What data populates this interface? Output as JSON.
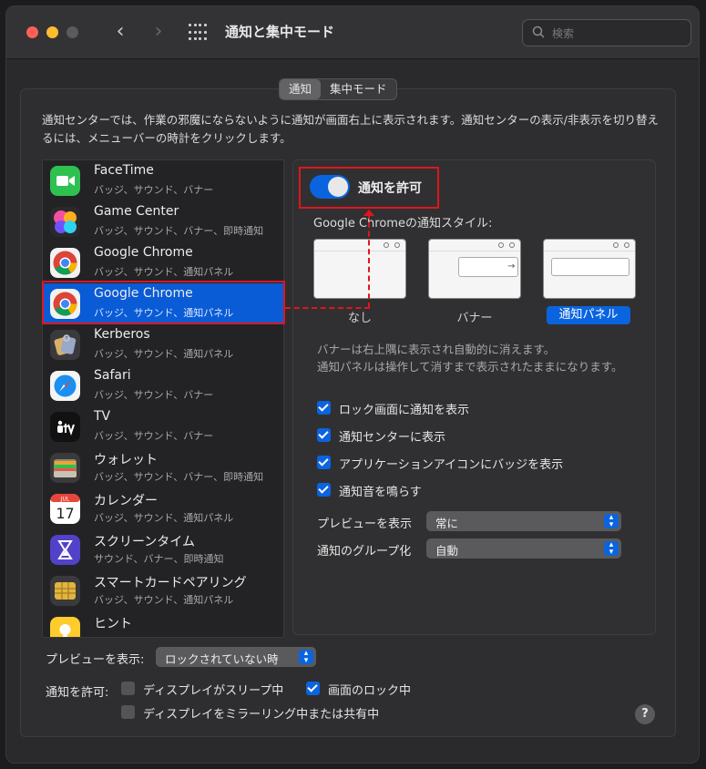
{
  "window": {
    "title": "通知と集中モード"
  },
  "search": {
    "placeholder": "検索"
  },
  "tabs": [
    {
      "label": "通知",
      "active": true
    },
    {
      "label": "集中モード",
      "active": false
    }
  ],
  "description": "通知センターでは、作業の邪魔にならないように通知が画面右上に表示されます。通知センターの表示/非表示を切り替えるには、メニューバーの時計をクリックします。",
  "apps": [
    {
      "name": "FaceTime",
      "sub": "バッジ、サウンド、バナー",
      "icon": "facetime-icon"
    },
    {
      "name": "Game Center",
      "sub": "バッジ、サウンド、バナー、即時通知",
      "icon": "game-center-icon"
    },
    {
      "name": "Google Chrome",
      "sub": "バッジ、サウンド、通知パネル",
      "icon": "chrome-icon"
    },
    {
      "name": "Google Chrome",
      "sub": "バッジ、サウンド、通知パネル",
      "icon": "chrome-icon",
      "selected": true
    },
    {
      "name": "Kerberos",
      "sub": "バッジ、サウンド、通知パネル",
      "icon": "kerberos-icon"
    },
    {
      "name": "Safari",
      "sub": "バッジ、サウンド、バナー",
      "icon": "safari-icon"
    },
    {
      "name": "TV",
      "sub": "バッジ、サウンド、バナー",
      "icon": "tv-icon"
    },
    {
      "name": "ウォレット",
      "sub": "バッジ、サウンド、バナー、即時通知",
      "icon": "wallet-icon"
    },
    {
      "name": "カレンダー",
      "sub": "バッジ、サウンド、通知パネル",
      "icon": "calendar-icon"
    },
    {
      "name": "スクリーンタイム",
      "sub": "サウンド、バナー、即時通知",
      "icon": "screen-time-icon"
    },
    {
      "name": "スマートカードペアリング",
      "sub": "バッジ、サウンド、通知パネル",
      "icon": "smartcard-icon"
    },
    {
      "name": "ヒント",
      "sub": "",
      "icon": "tips-icon"
    }
  ],
  "calendar_icon": {
    "month": "JUL",
    "day": "17"
  },
  "allow": {
    "label": "通知を許可",
    "on": true
  },
  "style": {
    "title": "Google Chromeの通知スタイル:",
    "options": [
      "なし",
      "バナー",
      "通知パネル"
    ],
    "selected": "通知パネル"
  },
  "hint": "バナーは右上隅に表示され自動的に消えます。\n通知パネルは操作して消すまで表示されたままになります。",
  "checkboxes": [
    {
      "label": "ロック画面に通知を表示",
      "checked": true
    },
    {
      "label": "通知センターに表示",
      "checked": true
    },
    {
      "label": "アプリケーションアイコンにバッジを表示",
      "checked": true
    },
    {
      "label": "通知音を鳴らす",
      "checked": true
    }
  ],
  "preview": {
    "label": "プレビューを表示",
    "value": "常に"
  },
  "grouping": {
    "label": "通知のグループ化",
    "value": "自動"
  },
  "bottom": {
    "preview_label": "プレビューを表示:",
    "preview_value": "ロックされていない時",
    "allow_label": "通知を許可:",
    "display_sleep": {
      "label": "ディスプレイがスリープ中",
      "checked": false
    },
    "screen_locked": {
      "label": "画面のロック中",
      "checked": true
    },
    "mirroring": {
      "label": "ディスプレイをミラーリング中または共有中",
      "checked": false
    }
  },
  "help": {
    "label": "?"
  },
  "colors": {
    "accent": "#0a64e0",
    "highlight": "#e0161b",
    "selected_row": "#0a5bd6"
  }
}
